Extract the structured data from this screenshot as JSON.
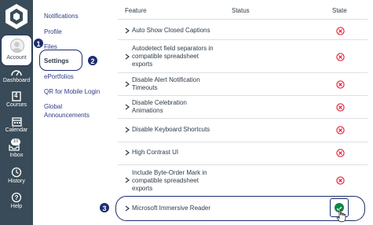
{
  "nav": {
    "items": [
      {
        "label": "Account",
        "icon": "user-avatar-icon"
      },
      {
        "label": "Dashboard",
        "icon": "dashboard-icon"
      },
      {
        "label": "Courses",
        "icon": "courses-icon",
        "badge": "4"
      },
      {
        "label": "Calendar",
        "icon": "calendar-icon"
      },
      {
        "label": "Inbox",
        "icon": "inbox-icon",
        "badge": "10"
      },
      {
        "label": "History",
        "icon": "history-icon"
      },
      {
        "label": "Help",
        "icon": "help-icon"
      }
    ]
  },
  "submenu": {
    "items": [
      "Notifications",
      "Profile",
      "Files",
      "Settings",
      "ePortfolios",
      "QR for Mobile Login",
      "Global",
      "Announcements"
    ]
  },
  "table": {
    "headers": {
      "feature": "Feature",
      "status": "Status",
      "state": "State"
    },
    "rows": [
      {
        "feature": [
          "Auto Show Closed Captions"
        ],
        "state": "off"
      },
      {
        "feature": [
          "Autodetect field separators in",
          "compatible spreadsheet",
          "exports"
        ],
        "state": "off"
      },
      {
        "feature": [
          "Disable Alert Notification",
          "Timeouts"
        ],
        "state": "off"
      },
      {
        "feature": [
          "Disable Celebration",
          "Animations"
        ],
        "state": "off"
      },
      {
        "feature": [
          "Disable Keyboard Shortcuts"
        ],
        "state": "off"
      },
      {
        "feature": [
          "High Contrast UI"
        ],
        "state": "off"
      },
      {
        "feature": [
          "Include Byte-Order Mark in",
          "compatible spreadsheet",
          "exports"
        ],
        "state": "off"
      },
      {
        "feature": [
          "Microsoft Immersive Reader"
        ],
        "state": "on"
      }
    ]
  },
  "markers": [
    "1",
    "2",
    "3"
  ],
  "colors": {
    "nav": "#394b58",
    "link": "#2d3b84",
    "marker": "#1d2d6e",
    "off": "#e0061f",
    "on": "#0b874b"
  }
}
